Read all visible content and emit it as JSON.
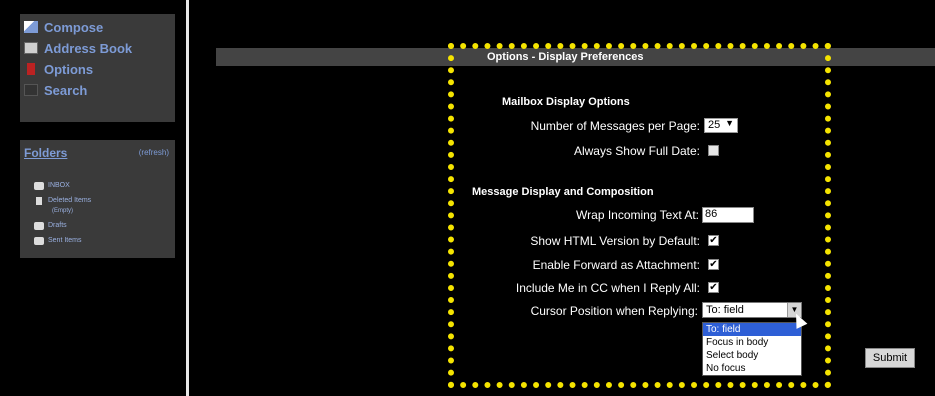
{
  "nav": {
    "compose": "Compose",
    "address_book": "Address Book",
    "options": "Options",
    "search": "Search"
  },
  "folders": {
    "title": "Folders",
    "refresh": "(refresh)",
    "items": [
      {
        "label": "INBOX"
      },
      {
        "label": "Deleted Items",
        "note": "(Empty)"
      },
      {
        "label": "Drafts"
      },
      {
        "label": "Sent Items"
      }
    ]
  },
  "prefs": {
    "title": "Options - Display Preferences",
    "mailbox_section": "Mailbox Display Options",
    "messages_per_page_label": "Number of Messages per Page:",
    "messages_per_page_value": "25",
    "full_date_label": "Always Show Full Date:",
    "message_section": "Message Display and Composition",
    "wrap_label": "Wrap Incoming Text At:",
    "wrap_value": "86",
    "html_label": "Show HTML Version by Default:",
    "forward_label": "Enable Forward as Attachment:",
    "cc_label": "Include Me in CC when I Reply All:",
    "cursor_label": "Cursor Position when Replying:",
    "cursor_value": "To: field",
    "cursor_options": [
      "To: field",
      "Focus in body",
      "Select body",
      "No focus"
    ],
    "check_mark": "✔",
    "submit": "Submit"
  },
  "colors": {
    "highlight": "#f5e400",
    "link": "#7d9bd6",
    "selected_option": "#2e5fd6"
  }
}
